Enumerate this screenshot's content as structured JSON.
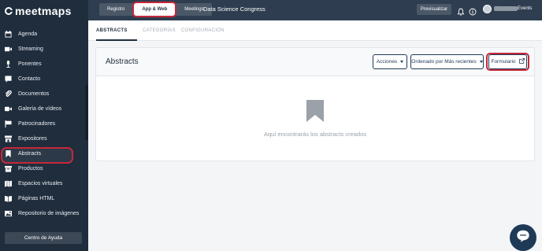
{
  "brand": {
    "name": "meetmaps"
  },
  "sidebar": {
    "items": [
      {
        "label": "Agenda",
        "icon": "calendar-icon"
      },
      {
        "label": "Streaming",
        "icon": "video-icon"
      },
      {
        "label": "Ponentes",
        "icon": "microphone-icon"
      },
      {
        "label": "Contacto",
        "icon": "chat-icon"
      },
      {
        "label": "Documentos",
        "icon": "paperclip-icon"
      },
      {
        "label": "Galería de vídeos",
        "icon": "camera-icon"
      },
      {
        "label": "Patrocinadores",
        "icon": "flag-icon"
      },
      {
        "label": "Expositores",
        "icon": "store-icon"
      },
      {
        "label": "Abstracts",
        "icon": "bookmark-icon",
        "active": true
      },
      {
        "label": "Productos",
        "icon": "box-icon"
      },
      {
        "label": "Espacios virtuales",
        "icon": "map-icon"
      },
      {
        "label": "Páginas HTML",
        "icon": "book-icon"
      },
      {
        "label": "Repositorio de imágenes",
        "icon": "images-icon"
      }
    ],
    "help_label": "Centro de Ayuda"
  },
  "topbar": {
    "tabs": [
      "Registro",
      "App & Web",
      "Meetings"
    ],
    "selected_tab": "App & Web",
    "event_title": "Data Science Congress",
    "preview_label": "Previsualizar",
    "user_name_hidden": "Meetmaps",
    "user_name_suffix": "Events"
  },
  "subtabs": [
    "ABSTRACTS",
    "CATEGORÍAS",
    "CONFIGURACIÓN"
  ],
  "main": {
    "title": "Abstracts",
    "actions_label": "Acciones",
    "sort_label": "Ordenado por Más recientes",
    "form_label": "Formulario",
    "empty_text": "Aquí encontrarás los abstracts creados"
  },
  "colors": {
    "sidebar_bg": "#1f2d3d",
    "topbar_bg": "#2e3e50",
    "accent": "#1f3a57",
    "highlight_ring": "#c62839"
  }
}
